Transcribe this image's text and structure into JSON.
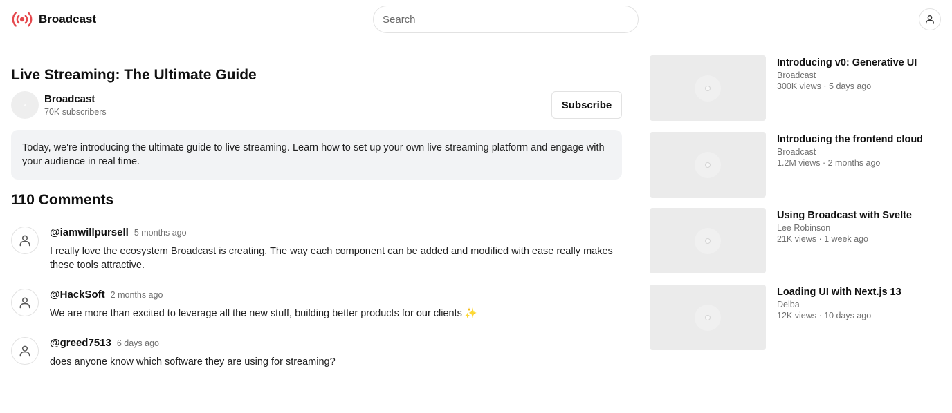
{
  "header": {
    "brand_name": "Broadcast",
    "search_placeholder": "Search",
    "brand_icon": "broadcast-icon",
    "user_icon": "user-icon"
  },
  "video": {
    "title": "Live Streaming: The Ultimate Guide",
    "channel_name": "Broadcast",
    "subscribers": "70K subscribers",
    "subscribe_label": "Subscribe",
    "description": "Today, we're introducing the ultimate guide to live streaming. Learn how to set up your own live streaming platform and engage with your audience in real time."
  },
  "comments": {
    "heading": "110 Comments",
    "items": [
      {
        "author": "@iamwillpursell",
        "time": "5 months ago",
        "text": "I really love the ecosystem Broadcast is creating. The way each component can be added and modified with ease really makes these tools attractive."
      },
      {
        "author": "@HackSoft",
        "time": "2 months ago",
        "text": "We are more than excited to leverage all the new stuff, building better products for our clients ✨"
      },
      {
        "author": "@greed7513",
        "time": "6 days ago",
        "text": "does anyone know which software they are using for streaming?"
      }
    ]
  },
  "related": [
    {
      "title": "Introducing v0: Generative UI",
      "channel": "Broadcast",
      "stats": "300K views · 5 days ago"
    },
    {
      "title": "Introducing the frontend cloud",
      "channel": "Broadcast",
      "stats": "1.2M views · 2 months ago"
    },
    {
      "title": "Using Broadcast with Svelte",
      "channel": "Lee Robinson",
      "stats": "21K views · 1 week ago"
    },
    {
      "title": "Loading UI with Next.js 13",
      "channel": "Delba",
      "stats": "12K views · 10 days ago"
    }
  ],
  "colors": {
    "brand_accent": "#e5484d",
    "description_bg": "#f2f3f5",
    "thumbnail_bg": "#ebebeb"
  }
}
